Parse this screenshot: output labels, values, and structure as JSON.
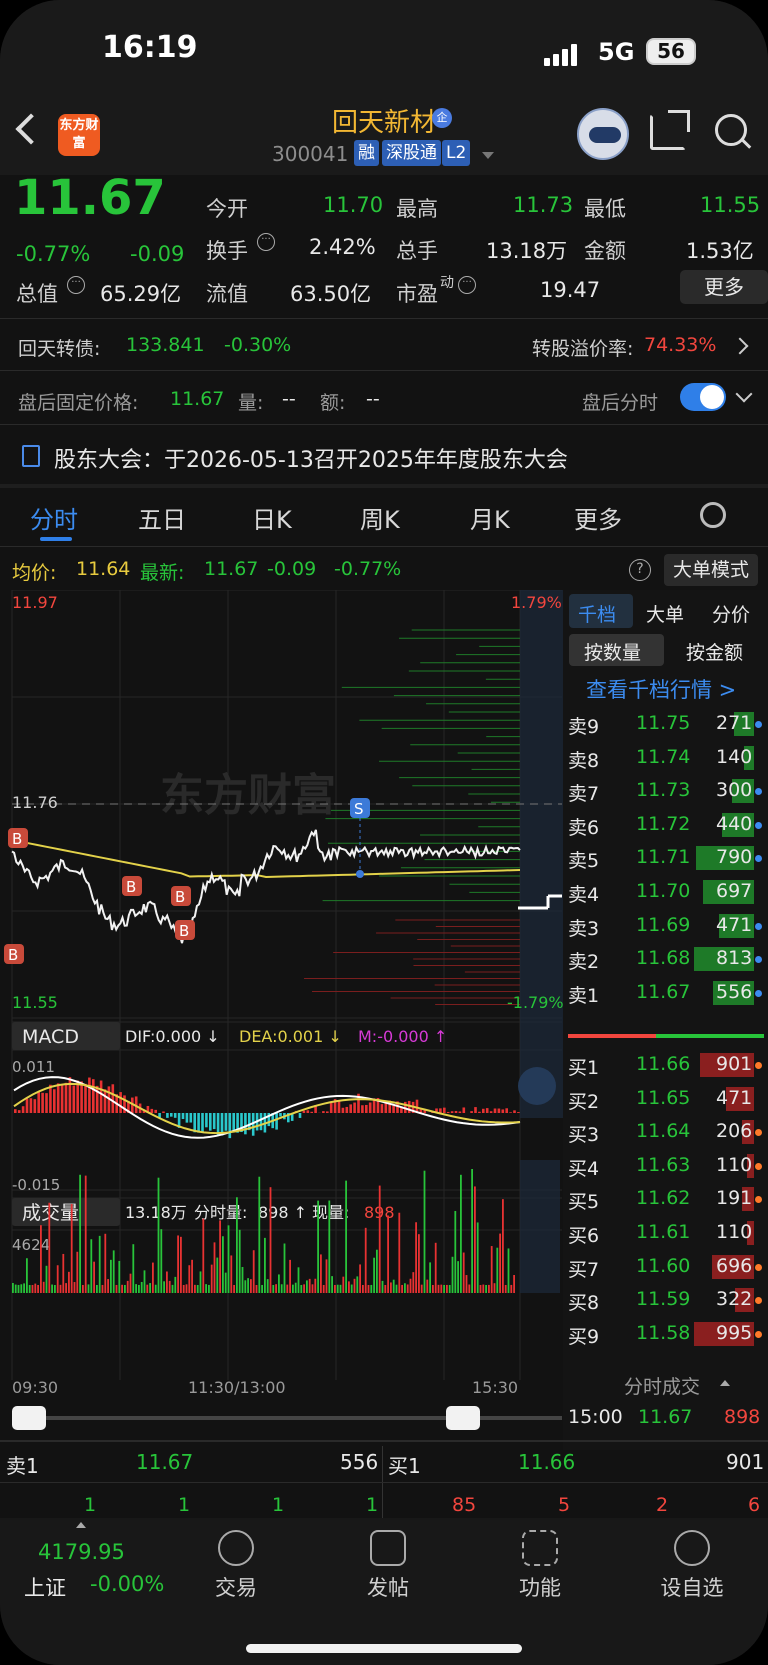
{
  "status_bar": {
    "time": "16:19",
    "network": "5G",
    "battery": "56"
  },
  "header": {
    "stock_name": "回天新材",
    "stock_code": "300041",
    "tags": [
      "融",
      "深股通",
      "L2"
    ],
    "corp_badge": "企",
    "logo_text": "东方财富"
  },
  "quote": {
    "price": "11.67",
    "change_pct": "-0.77%",
    "change": "-0.09",
    "open_label": "今开",
    "open": "11.70",
    "high_label": "最高",
    "high": "11.73",
    "low_label": "最低",
    "low": "11.55",
    "turnover_label": "换手",
    "turnover": "2.42%",
    "volume_label": "总手",
    "volume": "13.18万",
    "amount_label": "金额",
    "amount": "1.53亿",
    "mktcap_label": "总值",
    "mktcap": "65.29亿",
    "float_label": "流值",
    "float_cap": "63.50亿",
    "pe_label": "市盈",
    "pe_sup": "动",
    "pe": "19.47",
    "more_button": "更多"
  },
  "bond": {
    "label": "回天转债:",
    "price": "133.841",
    "change": "-0.30%",
    "premium_label": "转股溢价率:",
    "premium": "74.33%"
  },
  "after_hours": {
    "label": "盘后固定价格:",
    "price": "11.67",
    "vol_label": "量:",
    "vol": "--",
    "amt_label": "额:",
    "amt": "--",
    "toggle_label": "盘后分时",
    "toggle_on": true
  },
  "notice": {
    "text": "股东大会：于2026-05-13召开2025年年度股东大会"
  },
  "tabs": [
    "分时",
    "五日",
    "日K",
    "周K",
    "月K",
    "更多"
  ],
  "active_tab": "分时",
  "intraday": {
    "avg_label": "均价:",
    "avg": "11.64",
    "latest_label": "最新:",
    "latest": "11.67",
    "chg": "-0.09",
    "chg_pct": "-0.77%",
    "mode_button": "大单模式",
    "y_max": "11.97",
    "y_ref": "11.76",
    "y_min": "11.55",
    "pct_max": "1.79%",
    "pct_min": "-1.79%",
    "watermark": "东方财富",
    "markers": {
      "buy": "B",
      "sell": "S"
    },
    "times": [
      "09:30",
      "11:30/13:00",
      "15:30"
    ]
  },
  "macd": {
    "name": "MACD",
    "dif": "DIF:0.000 ↓",
    "dea": "DEA:0.001 ↓",
    "m": "M:-0.000 ↑",
    "y_max": "0.011",
    "y_min": "-0.015"
  },
  "volume_panel": {
    "name": "成交量",
    "total": "13.18万",
    "tick_label": "分时量:",
    "tick": "898 ↑",
    "cur_label": "现量:",
    "cur": "898",
    "y_max": "4624"
  },
  "order_book": {
    "side_tabs": [
      "千档",
      "大单",
      "分价"
    ],
    "sub_tabs": [
      "按数量",
      "按金额"
    ],
    "link": "查看千档行情 >",
    "asks": [
      {
        "l": "卖9",
        "p": "11.75",
        "q": "271"
      },
      {
        "l": "卖8",
        "p": "11.74",
        "q": "140"
      },
      {
        "l": "卖7",
        "p": "11.73",
        "q": "300"
      },
      {
        "l": "卖6",
        "p": "11.72",
        "q": "440"
      },
      {
        "l": "卖5",
        "p": "11.71",
        "q": "790"
      },
      {
        "l": "卖4",
        "p": "11.70",
        "q": "697"
      },
      {
        "l": "卖3",
        "p": "11.69",
        "q": "471"
      },
      {
        "l": "卖2",
        "p": "11.68",
        "q": "813"
      },
      {
        "l": "卖1",
        "p": "11.67",
        "q": "556"
      }
    ],
    "bids": [
      {
        "l": "买1",
        "p": "11.66",
        "q": "901"
      },
      {
        "l": "买2",
        "p": "11.65",
        "q": "471"
      },
      {
        "l": "买3",
        "p": "11.64",
        "q": "206"
      },
      {
        "l": "买4",
        "p": "11.63",
        "q": "110"
      },
      {
        "l": "买5",
        "p": "11.62",
        "q": "191"
      },
      {
        "l": "买6",
        "p": "11.61",
        "q": "110"
      },
      {
        "l": "买7",
        "p": "11.60",
        "q": "696"
      },
      {
        "l": "买8",
        "p": "11.59",
        "q": "322"
      },
      {
        "l": "买9",
        "p": "11.58",
        "q": "995"
      }
    ],
    "ticks_label": "分时成交",
    "last_tick": {
      "time": "15:00",
      "price": "11.67",
      "vol": "898"
    }
  },
  "level1": {
    "ask_label": "卖1",
    "ask_price": "11.67",
    "ask_vol": "556",
    "bid_label": "买1",
    "bid_price": "11.66",
    "bid_vol": "901",
    "ask_queue": [
      "1",
      "1",
      "1",
      "1"
    ],
    "bid_queue": [
      "85",
      "5",
      "2",
      "6"
    ]
  },
  "bottom_nav": {
    "index_value": "4179.95",
    "index_name": "上证",
    "index_chg": "-0.00%",
    "items": [
      "交易",
      "发帖",
      "功能",
      "设自选"
    ]
  }
}
